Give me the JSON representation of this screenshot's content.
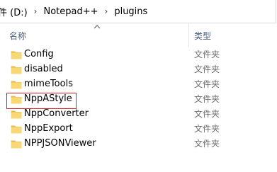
{
  "address": {
    "drive": "件 (D:)",
    "folder1": "Notepad++",
    "folder2": "plugins",
    "separator": "›"
  },
  "columns": {
    "name": "名称",
    "type": "类型"
  },
  "items": [
    {
      "name": "Config",
      "type": "文件夹"
    },
    {
      "name": "disabled",
      "type": "文件夹"
    },
    {
      "name": "mimeTools",
      "type": "文件夹"
    },
    {
      "name": "NppAStyle",
      "type": "文件夹"
    },
    {
      "name": "NppConverter",
      "type": "文件夹"
    },
    {
      "name": "NppExport",
      "type": "文件夹"
    },
    {
      "name": "NPPJSONViewer",
      "type": "文件夹"
    }
  ],
  "highlighted_item": "NppAStyle",
  "colors": {
    "highlight_border": "#e0201f",
    "folder_fill": "#f8d775",
    "header_text": "#4c607a"
  },
  "icons": {
    "folder": "folder-icon",
    "sort": "sort-ascending-icon",
    "separator": "chevron-right-icon"
  }
}
